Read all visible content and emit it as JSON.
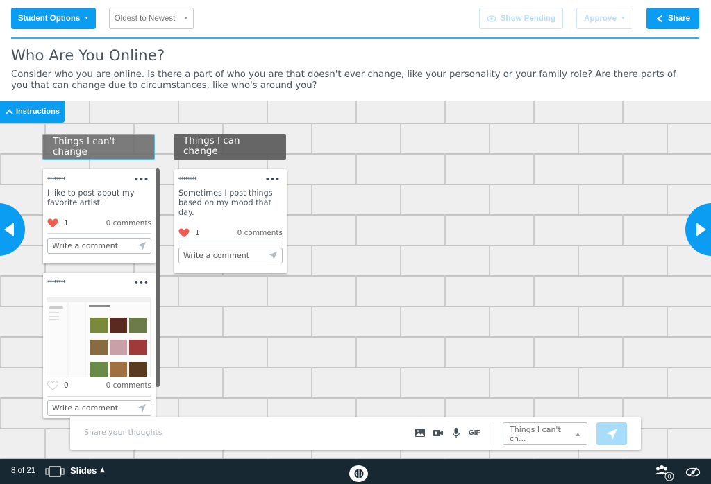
{
  "toolbar": {
    "student_options_label": "Student Options",
    "sort_label": "Oldest to Newest",
    "show_pending_label": "Show Pending",
    "approve_label": "Approve",
    "share_label": "Share"
  },
  "header": {
    "title": "Who Are You Online?",
    "description": "Consider who you are online. Is there a part of who you are that doesn't ever change, like your personality or your family role? Are there parts of you that can change due to circumstances, like who's around you?"
  },
  "board": {
    "instructions_label": "Instructions",
    "columns": [
      {
        "title": "Things I can't change",
        "posts": [
          {
            "author": "********",
            "text": "I like to post about my favorite artist.",
            "likes": "1",
            "liked": true,
            "comments": "0 comments",
            "comment_placeholder": "Write a comment"
          },
          {
            "author": "********",
            "text": "",
            "image": "screenshot of a recipe app with food photo grid",
            "likes": "0",
            "liked": false,
            "comments": "0 comments",
            "comment_placeholder": "Write a comment"
          }
        ]
      },
      {
        "title": "Things I can change",
        "posts": [
          {
            "author": "********",
            "text": "Sometimes I post things based on my mood that day.",
            "likes": "1",
            "liked": true,
            "comments": "0 comments",
            "comment_placeholder": "Write a comment"
          }
        ]
      }
    ]
  },
  "composer": {
    "placeholder": "Share your thoughts",
    "gif_label": "GIF",
    "selected_column": "Things I can't ch..."
  },
  "bottom_bar": {
    "slide_position": "8 of 21",
    "slides_label": "Slides",
    "participants_count": "0"
  },
  "colors": {
    "accent": "#0a9df2",
    "like": "#ef5b4f",
    "bottom_bar": "#172833"
  }
}
